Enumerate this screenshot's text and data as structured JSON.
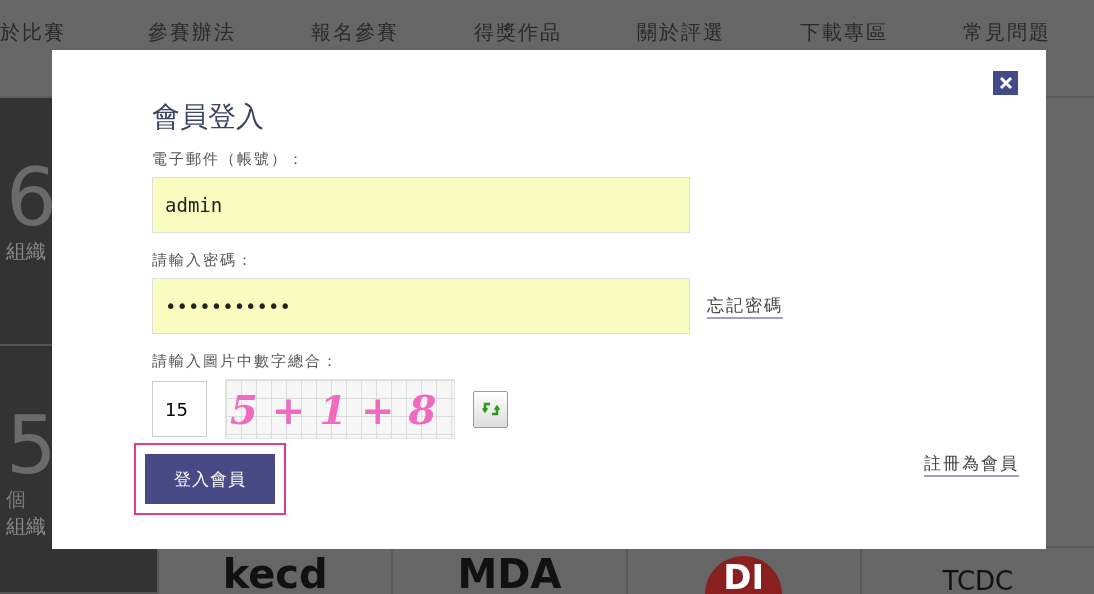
{
  "nav": {
    "items": [
      "於比賽",
      "參賽辦法",
      "報名參賽",
      "得獎作品",
      "關於評選",
      "下載專區",
      "常見問題"
    ]
  },
  "side_stats": [
    {
      "number": "6",
      "label": "組織"
    },
    {
      "number": "5",
      "unit": "個",
      "label": "組織"
    }
  ],
  "logos": [
    "kecd",
    "MDA",
    "DI",
    "TCDC"
  ],
  "dialog": {
    "title": "會員登入",
    "email": {
      "label": "電子郵件（帳號）：",
      "value": "admin"
    },
    "password": {
      "label": "請輸入密碼：",
      "value": "•••••••••••",
      "forgot_link": "忘記密碼"
    },
    "captcha": {
      "label": "請輸入圖片中數字總合：",
      "value": "15",
      "image_text": "5 + 1 + 8"
    },
    "submit": "登入會員",
    "register_link": "註冊為會員"
  }
}
